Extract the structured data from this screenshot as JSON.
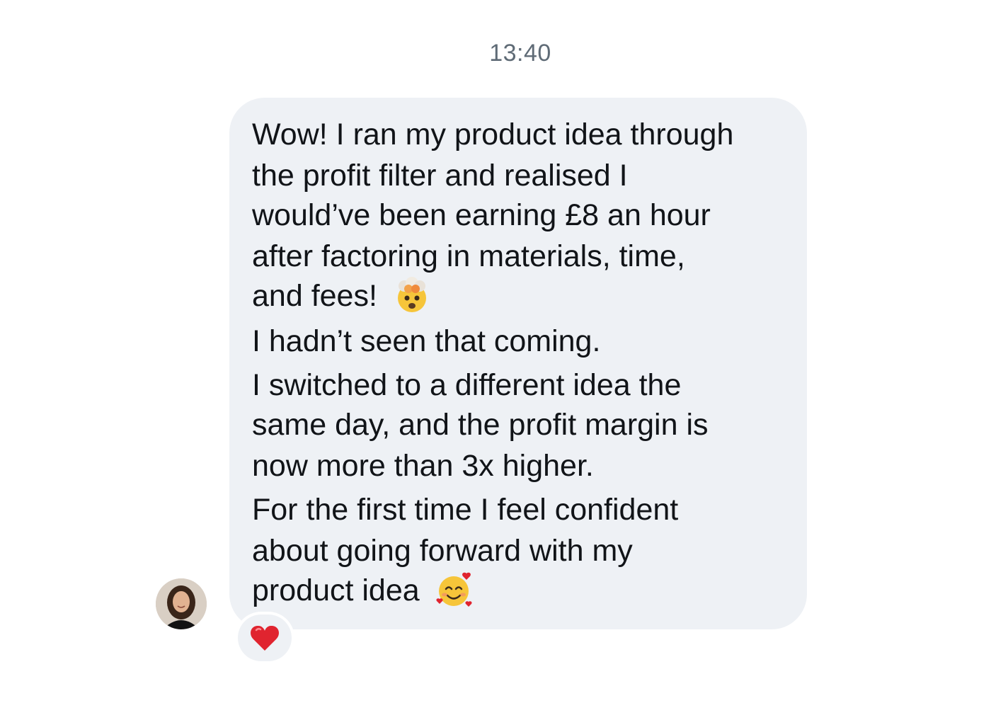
{
  "timestamp": "13:40",
  "message": {
    "lines": [
      "Wow! I ran my product idea through",
      "the profit filter and realised I",
      "would’ve been earning  £8 an hour",
      "after factoring in materials, time,",
      "and fees!",
      "I hadn’t seen that coming.",
      "I switched to a different idea the",
      "same day, and the profit margin is",
      "now more than 3x higher.",
      "For the first time I feel confident",
      "about going forward with my",
      "product idea"
    ],
    "emojis": [
      "exploding-head-emoji",
      "smiling-face-with-hearts-emoji"
    ]
  },
  "reaction": {
    "icon": "heart-icon",
    "color": "#e0242f"
  },
  "colors": {
    "bubble": "#eef1f5",
    "text": "#111418",
    "timestamp": "#5f6b76"
  }
}
